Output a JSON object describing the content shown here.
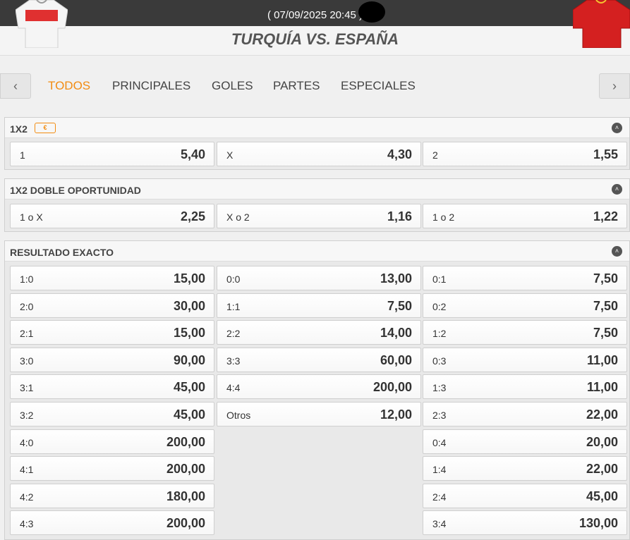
{
  "header": {
    "datetime": "( 07/09/2025 20:45 )",
    "title": "TURQUÍA VS. ESPAÑA",
    "home_shirt_colors": [
      "#ffffff",
      "#e03030"
    ],
    "away_shirt_color": "#d42020"
  },
  "tabs": {
    "prev_icon": "‹",
    "next_icon": "›",
    "items": [
      {
        "label": "TODOS",
        "active": true
      },
      {
        "label": "PRINCIPALES",
        "active": false
      },
      {
        "label": "GOLES",
        "active": false
      },
      {
        "label": "PARTES",
        "active": false
      },
      {
        "label": "ESPECIALES",
        "active": false
      }
    ]
  },
  "accent_color": "#f28c12",
  "markets": {
    "m1x2": {
      "title": "1X2",
      "badge": "€",
      "collapse_icon": "˄",
      "outcomes": [
        {
          "label": "1",
          "odd": "5,40"
        },
        {
          "label": "X",
          "odd": "4,30"
        },
        {
          "label": "2",
          "odd": "1,55"
        }
      ]
    },
    "doble": {
      "title": "1X2 DOBLE OPORTUNIDAD",
      "collapse_icon": "˄",
      "outcomes": [
        {
          "label": "1 o X",
          "odd": "2,25"
        },
        {
          "label": "X o 2",
          "odd": "1,16"
        },
        {
          "label": "1 o 2",
          "odd": "1,22"
        }
      ]
    },
    "exacto": {
      "title": "RESULTADO EXACTO",
      "collapse_icon": "˄",
      "col1": [
        {
          "label": "1:0",
          "odd": "15,00"
        },
        {
          "label": "2:0",
          "odd": "30,00"
        },
        {
          "label": "2:1",
          "odd": "15,00"
        },
        {
          "label": "3:0",
          "odd": "90,00"
        },
        {
          "label": "3:1",
          "odd": "45,00"
        },
        {
          "label": "3:2",
          "odd": "45,00"
        },
        {
          "label": "4:0",
          "odd": "200,00"
        },
        {
          "label": "4:1",
          "odd": "200,00"
        },
        {
          "label": "4:2",
          "odd": "180,00"
        },
        {
          "label": "4:3",
          "odd": "200,00"
        }
      ],
      "col2": [
        {
          "label": "0:0",
          "odd": "13,00"
        },
        {
          "label": "1:1",
          "odd": "7,50"
        },
        {
          "label": "2:2",
          "odd": "14,00"
        },
        {
          "label": "3:3",
          "odd": "60,00"
        },
        {
          "label": "4:4",
          "odd": "200,00"
        },
        {
          "label": "Otros",
          "odd": "12,00"
        }
      ],
      "col3": [
        {
          "label": "0:1",
          "odd": "7,50"
        },
        {
          "label": "0:2",
          "odd": "7,50"
        },
        {
          "label": "1:2",
          "odd": "7,50"
        },
        {
          "label": "0:3",
          "odd": "11,00"
        },
        {
          "label": "1:3",
          "odd": "11,00"
        },
        {
          "label": "2:3",
          "odd": "22,00"
        },
        {
          "label": "0:4",
          "odd": "20,00"
        },
        {
          "label": "1:4",
          "odd": "22,00"
        },
        {
          "label": "2:4",
          "odd": "45,00"
        },
        {
          "label": "3:4",
          "odd": "130,00"
        }
      ]
    }
  }
}
